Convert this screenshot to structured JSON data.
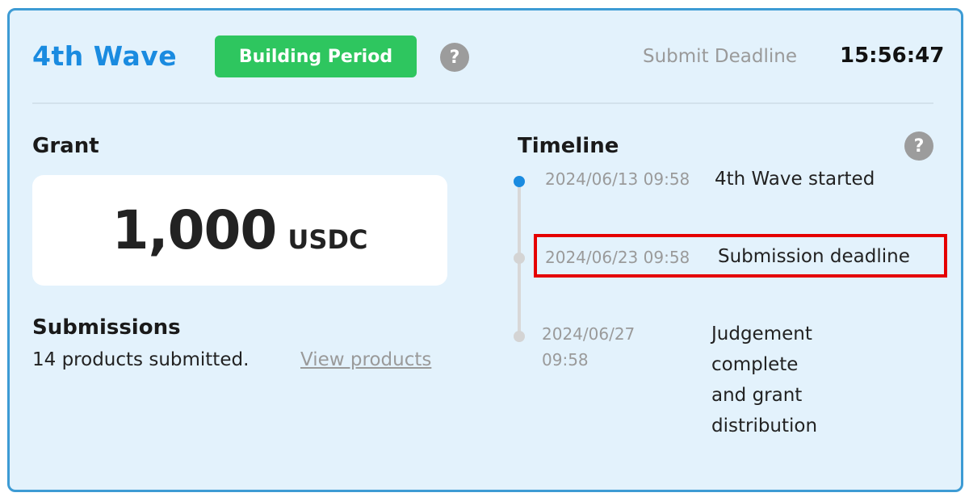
{
  "header": {
    "wave_title": "4th Wave",
    "status_badge": "Building Period",
    "help_glyph": "?",
    "deadline_label": "Submit Deadline",
    "deadline_time": "15:56:47"
  },
  "grant": {
    "title": "Grant",
    "amount": "1,000",
    "unit": "USDC"
  },
  "submissions": {
    "title": "Submissions",
    "summary": "14 products submitted.",
    "link_label": "View products"
  },
  "timeline": {
    "title": "Timeline",
    "help_glyph": "?",
    "events": [
      {
        "date": "2024/06/13 09:58",
        "desc": "4th Wave started"
      },
      {
        "date": "2024/06/23 09:58",
        "desc": "Submission deadline"
      },
      {
        "date_line1": "2024/06/27",
        "date_line2": "09:58",
        "desc_lines": [
          "Judgement",
          "complete",
          "and grant",
          "distribution"
        ]
      }
    ]
  },
  "colors": {
    "accent_blue": "#1a8be0",
    "badge_green": "#2ec65f",
    "card_bg": "#e3f2fc",
    "highlight_red": "#e50000"
  }
}
